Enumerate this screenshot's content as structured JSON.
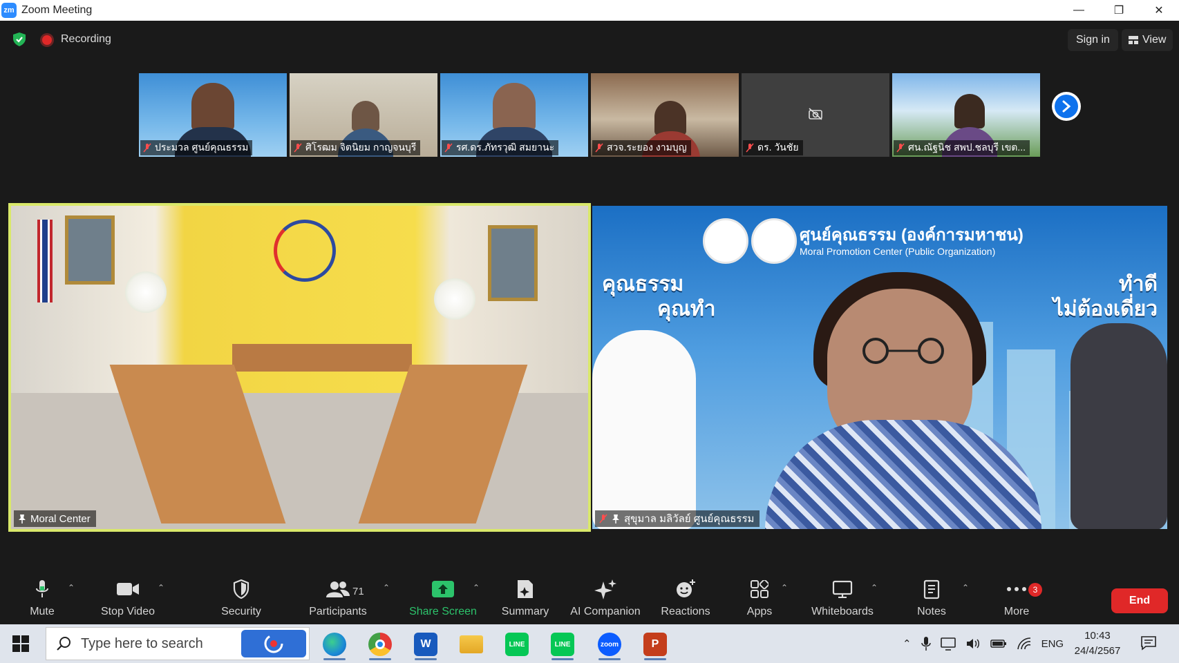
{
  "window": {
    "title": "Zoom Meeting",
    "logo_text": "zm",
    "controls": {
      "minimize": "—",
      "restore": "❐",
      "close": "✕"
    }
  },
  "meeting_top": {
    "recording_label": "Recording",
    "sign_in_label": "Sign in",
    "view_label": "View"
  },
  "thumbnails": [
    {
      "name": "ประมวล ศูนย์คุณธรรม",
      "background": "blue-mascot",
      "muted": true
    },
    {
      "name": "ศิโรฒม จิตนิยม กาญจนบุรี",
      "background": "office",
      "muted": true
    },
    {
      "name": "รศ.ดร.ภัทรวุฒิ สมยานะ",
      "background": "blue-mascot",
      "muted": true
    },
    {
      "name": "สวจ.ระยอง งามบุญ",
      "background": "room",
      "muted": true
    },
    {
      "name": "ดร. วันชัย",
      "background": "camera-off",
      "muted": true
    },
    {
      "name": "ศน.ณัฐนิช สพป.ชลบุรี เขต...",
      "background": "school",
      "muted": true
    }
  ],
  "main_tiles": {
    "left": {
      "name": "Moral Center",
      "pinned": true,
      "active_speaker": true
    },
    "right": {
      "name": "สุขุมาล มลิวัลย์ ศูนย์คุณธรรม",
      "muted": true,
      "pinned": true,
      "banner_title": "ศูนย์คุณธรรม (องค์การมหาชน)",
      "banner_subtitle": "Moral Promotion Center (Public Organization)",
      "slogan_left": [
        "คุณธรรม",
        "คุณทำ"
      ],
      "slogan_right": [
        "ทำดี",
        "ไม่ต้องเดี่ยว"
      ]
    }
  },
  "toolbar": {
    "mute": "Mute",
    "stop_video": "Stop Video",
    "security": "Security",
    "participants": "Participants",
    "participants_count": "71",
    "share_screen": "Share Screen",
    "summary": "Summary",
    "ai_companion": "AI Companion",
    "reactions": "Reactions",
    "apps": "Apps",
    "whiteboards": "Whiteboards",
    "notes": "Notes",
    "more": "More",
    "more_badge": "3",
    "end": "End"
  },
  "taskbar": {
    "search_placeholder": "Type here to search",
    "apps": [
      "edge",
      "chrome",
      "word",
      "file-explorer",
      "line",
      "line",
      "zoom",
      "powerpoint"
    ],
    "app_labels": {
      "word": "W",
      "line": "LINE",
      "zoom": "zoom",
      "powerpoint": "P"
    },
    "language": "ENG",
    "time": "10:43",
    "date": "24/4/2567"
  },
  "colors": {
    "zoom_blue": "#0e72ed",
    "active_border": "#d9e86a",
    "share_green": "#2cc36b",
    "end_red": "#e02828"
  }
}
